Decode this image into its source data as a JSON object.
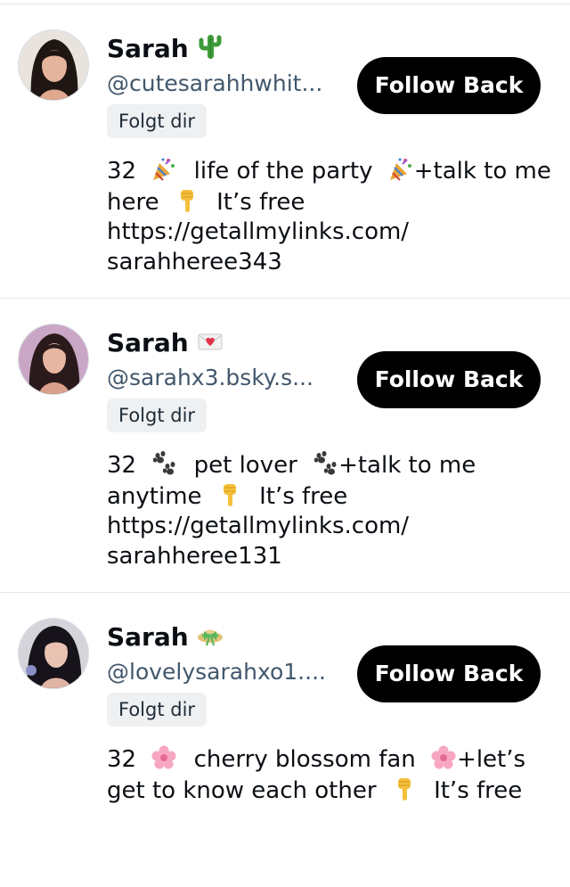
{
  "profiles": [
    {
      "display_name": "Sarah",
      "name_emoji": "cactus-emoji",
      "handle": "@cutesarahhwhit...",
      "follows_badge": "Folgt dir",
      "follow_button_label": "Follow Back",
      "bio": {
        "line1_prefix": "32",
        "line1_emoji": "party-popper-emoji",
        "line1_middle": "life of the party",
        "line1_end_emoji": "party-popper-emoji",
        "line1_suffix": "+talk to me",
        "line2_prefix": "here",
        "line2_emoji": "pointing-down-emoji",
        "line2_suffix": "It’s free",
        "line3": "https://getallmylinks.com/",
        "line4": "sarahheree343"
      }
    },
    {
      "display_name": "Sarah",
      "name_emoji": "love-letter-emoji",
      "handle": "@sarahx3.bsky.s...",
      "follows_badge": "Folgt dir",
      "follow_button_label": "Follow Back",
      "bio": {
        "line1_prefix": "32",
        "line1_emoji": "paw-prints-emoji",
        "line1_middle": "pet lover",
        "line1_end_emoji": "paw-prints-emoji",
        "line1_suffix": "+talk to me",
        "line2_prefix": "anytime",
        "line2_emoji": "pointing-down-emoji",
        "line2_suffix": "It’s free",
        "line3": "https://getallmylinks.com/",
        "line4": "sarahheree131"
      }
    },
    {
      "display_name": "Sarah",
      "name_emoji": "hat-with-bow-emoji",
      "handle": "@lovelysarahxo1....",
      "follows_badge": "Folgt dir",
      "follow_button_label": "Follow Back",
      "bio": {
        "line1_prefix": "32",
        "line1_emoji": "cherry-blossom-emoji",
        "line1_middle": "cherry blossom fan",
        "line1_end_emoji": "cherry-blossom-emoji",
        "line1_suffix": "+let’s",
        "line2_prefix": "get to know each other",
        "line2_emoji": "pointing-down-emoji",
        "line2_suffix": "It’s free"
      }
    }
  ],
  "colors": {
    "button_background": "#000000",
    "button_text": "#ffffff",
    "handle_text": "#42576c",
    "badge_background": "#eef0f2",
    "divider": "#e3e6ea"
  }
}
